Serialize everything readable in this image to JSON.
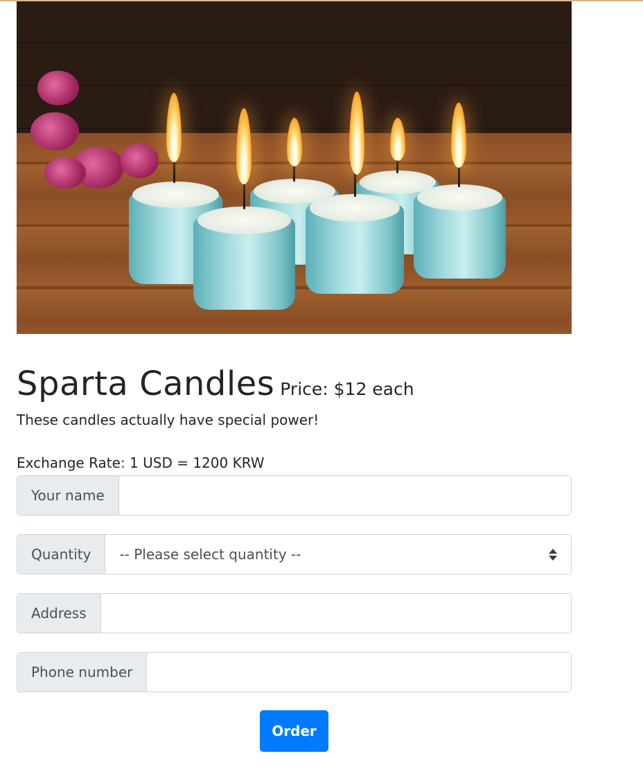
{
  "product": {
    "image_alt": "Light blue candles lit on a wooden table with pink flowers",
    "name": "Sparta Candles",
    "price_text": "Price: $12 each",
    "description": "These candles actually have special power!",
    "exchange_rate": "Exchange Rate: 1 USD = 1200 KRW"
  },
  "form": {
    "name_label": "Your name",
    "name_value": "",
    "quantity_label": "Quantity",
    "quantity_selected": "-- Please select quantity --",
    "address_label": "Address",
    "address_value": "",
    "phone_label": "Phone number",
    "phone_value": "",
    "submit_label": "Order"
  },
  "colors": {
    "primary_button": "#007bff",
    "addon_background": "#e9ecef",
    "border": "#ced4da",
    "top_border": "#d9b48a"
  }
}
